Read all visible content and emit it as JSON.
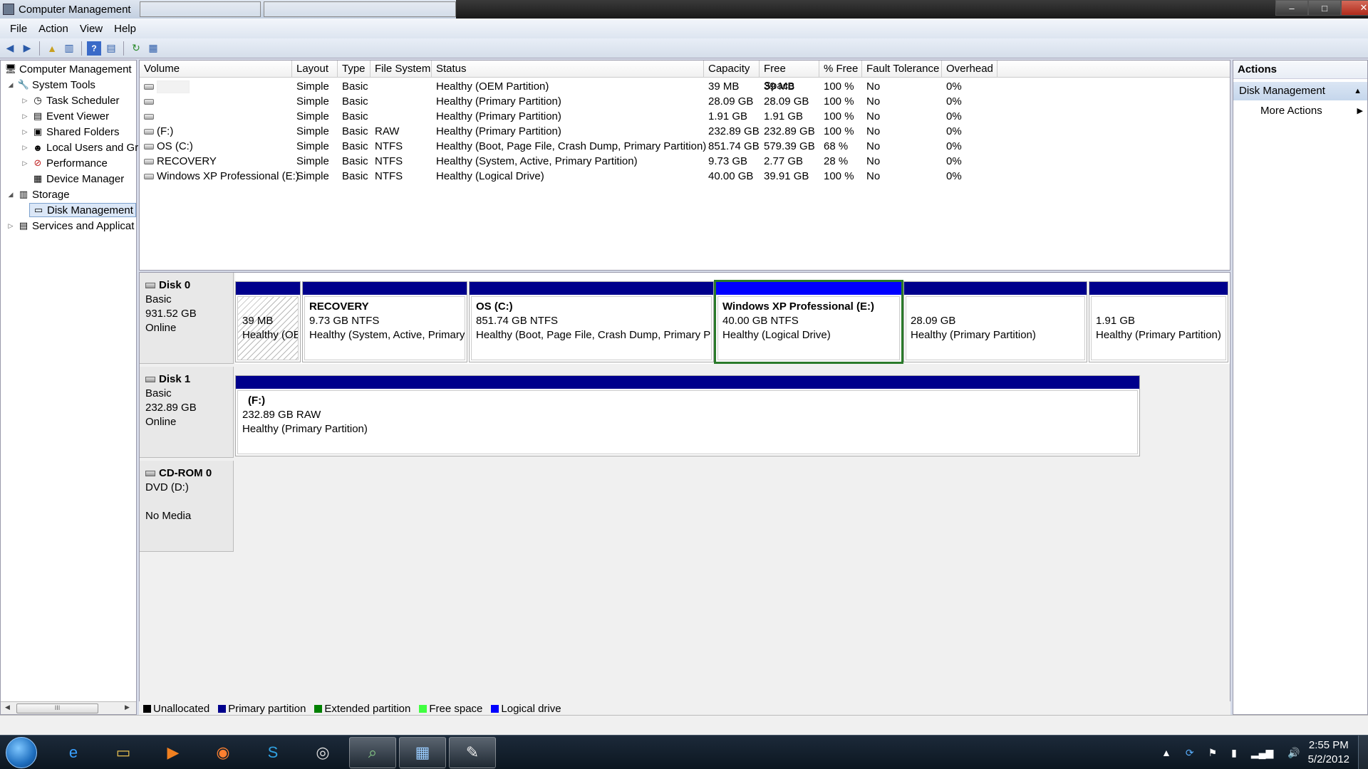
{
  "window": {
    "title": "Computer Management",
    "controls": {
      "minimize": "–",
      "maximize": "□",
      "close": "✕"
    }
  },
  "menu": [
    "File",
    "Action",
    "View",
    "Help"
  ],
  "tree": {
    "items": [
      {
        "label": "Computer Management",
        "icon": "computer-icon",
        "glyph": "🖥"
      },
      {
        "label": "System Tools",
        "icon": "tools-icon",
        "glyph": "🔧"
      },
      {
        "label": "Task Scheduler",
        "icon": "clock-icon",
        "glyph": "◷"
      },
      {
        "label": "Event Viewer",
        "icon": "event-viewer-icon",
        "glyph": "▤"
      },
      {
        "label": "Shared Folders",
        "icon": "folder-icon",
        "glyph": "▣"
      },
      {
        "label": "Local Users and Gro",
        "icon": "users-icon",
        "glyph": "☻"
      },
      {
        "label": "Performance",
        "icon": "performance-icon",
        "glyph": "⊘"
      },
      {
        "label": "Device Manager",
        "icon": "device-manager-icon",
        "glyph": "▦"
      },
      {
        "label": "Storage",
        "icon": "storage-icon",
        "glyph": "▥"
      },
      {
        "label": "Disk Management",
        "icon": "disk-icon",
        "glyph": "▭"
      },
      {
        "label": "Services and Applicat",
        "icon": "services-icon",
        "glyph": "▤"
      }
    ],
    "scroll_thumb": "III"
  },
  "volumes": {
    "columns": [
      "Volume",
      "Layout",
      "Type",
      "File System",
      "Status",
      "Capacity",
      "Free Space",
      "% Free",
      "Fault Tolerance",
      "Overhead"
    ],
    "rows": [
      [
        "",
        "Simple",
        "Basic",
        "",
        "Healthy (OEM Partition)",
        "39 MB",
        "39 MB",
        "100 %",
        "No",
        "0%"
      ],
      [
        "",
        "Simple",
        "Basic",
        "",
        "Healthy (Primary Partition)",
        "28.09 GB",
        "28.09 GB",
        "100 %",
        "No",
        "0%"
      ],
      [
        "",
        "Simple",
        "Basic",
        "",
        "Healthy (Primary Partition)",
        "1.91 GB",
        "1.91 GB",
        "100 %",
        "No",
        "0%"
      ],
      [
        "(F:)",
        "Simple",
        "Basic",
        "RAW",
        "Healthy (Primary Partition)",
        "232.89 GB",
        "232.89 GB",
        "100 %",
        "No",
        "0%"
      ],
      [
        "OS (C:)",
        "Simple",
        "Basic",
        "NTFS",
        "Healthy (Boot, Page File, Crash Dump, Primary Partition)",
        "851.74 GB",
        "579.39 GB",
        "68 %",
        "No",
        "0%"
      ],
      [
        "RECOVERY",
        "Simple",
        "Basic",
        "NTFS",
        "Healthy (System, Active, Primary Partition)",
        "9.73 GB",
        "2.77 GB",
        "28 %",
        "No",
        "0%"
      ],
      [
        "Windows XP Professional (E:)",
        "Simple",
        "Basic",
        "NTFS",
        "Healthy (Logical Drive)",
        "40.00 GB",
        "39.91 GB",
        "100 %",
        "No",
        "0%"
      ]
    ]
  },
  "disks": [
    {
      "name": "Disk 0",
      "type": "Basic",
      "size": "931.52 GB",
      "status": "Online",
      "partitions": [
        {
          "name": "",
          "size": "39 MB",
          "status": "Healthy (OE"
        },
        {
          "name": "RECOVERY",
          "size": "9.73 GB NTFS",
          "status": "Healthy (System, Active, Primary"
        },
        {
          "name": "OS  (C:)",
          "size": "851.74 GB NTFS",
          "status": "Healthy (Boot, Page File, Crash Dump, Primary Par"
        },
        {
          "name": "Windows XP Professional  (E:)",
          "size": "40.00 GB NTFS",
          "status": "Healthy (Logical Drive)"
        },
        {
          "name": "",
          "size": "28.09 GB",
          "status": "Healthy (Primary Partition)"
        },
        {
          "name": "",
          "size": "1.91 GB",
          "status": "Healthy (Primary Partition)"
        }
      ]
    },
    {
      "name": "Disk 1",
      "type": "Basic",
      "size": "232.89 GB",
      "status": "Online",
      "partitions": [
        {
          "name": "(F:)",
          "size": "232.89 GB RAW",
          "status": "Healthy (Primary Partition)"
        }
      ]
    },
    {
      "name": "CD-ROM 0",
      "type": "DVD (D:)",
      "size": "",
      "status": "No Media",
      "partitions": []
    }
  ],
  "legend": [
    {
      "label": "Unallocated",
      "color": "#000000"
    },
    {
      "label": "Primary partition",
      "color": "#00008c"
    },
    {
      "label": "Extended partition",
      "color": "#008000"
    },
    {
      "label": "Free space",
      "color": "#40ff40"
    },
    {
      "label": "Logical drive",
      "color": "#0000ff"
    }
  ],
  "actions": {
    "header": "Actions",
    "section": "Disk Management",
    "items": [
      "More Actions"
    ]
  },
  "taskbar": {
    "apps": [
      {
        "name": "internet-explorer",
        "glyph": "e"
      },
      {
        "name": "file-explorer",
        "glyph": "▭"
      },
      {
        "name": "media-player",
        "glyph": "▶"
      },
      {
        "name": "firefox",
        "glyph": "◉"
      },
      {
        "name": "skype",
        "glyph": "S"
      },
      {
        "name": "dell",
        "glyph": "◎"
      },
      {
        "name": "search-app",
        "glyph": "⌕"
      },
      {
        "name": "computer-management",
        "glyph": "▦"
      },
      {
        "name": "paint",
        "glyph": "✎"
      }
    ],
    "clock_time": "2:55 PM",
    "clock_date": "5/2/2012"
  }
}
